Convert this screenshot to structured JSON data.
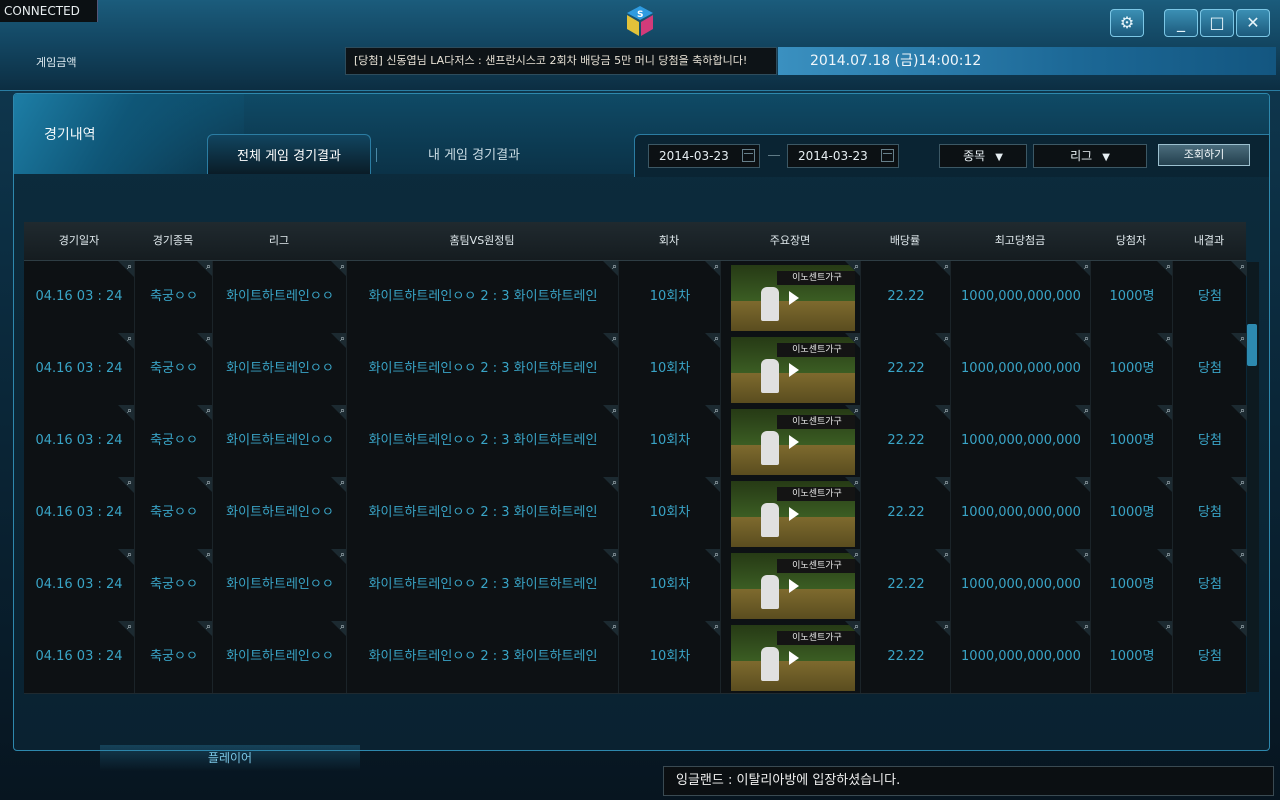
{
  "status": {
    "connection": "CONNECTED"
  },
  "header": {
    "game_amount_label": "게임금액",
    "ticker": "[당첨] 신동엽님 LA다저스 : 샌프란시스코 2회차 배당금 5만 머니 당첨을 축하합니다!",
    "datetime": "2014.07.18 (금)14:00:12"
  },
  "window_controls": {
    "settings_icon": "gear-icon",
    "minimize_icon": "minimize-icon",
    "maximize_icon": "maximize-icon",
    "close_icon": "close-icon"
  },
  "panel": {
    "title": "경기내역",
    "tabs": [
      {
        "label": "전체 게임 경기결과",
        "active": true
      },
      {
        "label": "내 게임 경기결과",
        "active": false
      }
    ],
    "filters": {
      "date_from": "2014-03-23",
      "date_to": "2014-03-23",
      "sport_select": "종목",
      "league_select": "리그",
      "search_button": "조회하기"
    }
  },
  "table": {
    "columns": [
      "경기일자",
      "경기종목",
      "리그",
      "홈팀VS원정팀",
      "회차",
      "주요장면",
      "배당률",
      "최고당첨금",
      "당첨자",
      "내결과"
    ],
    "rows": [
      {
        "date": "04.16  03 : 24",
        "sport": "축궁ㅇㅇ",
        "league": "화이트하트레인ㅇㅇ",
        "match": "화이트하트레인ㅇㅇ 2 : 3 화이트하트레인",
        "round": "10회차",
        "thumb_text": "이노센트가구",
        "odds": "22.22",
        "top_prize": "1000,000,000,000",
        "winners": "1000명",
        "my_result": "당첨"
      },
      {
        "date": "04.16  03 : 24",
        "sport": "축궁ㅇㅇ",
        "league": "화이트하트레인ㅇㅇ",
        "match": "화이트하트레인ㅇㅇ 2 : 3 화이트하트레인",
        "round": "10회차",
        "thumb_text": "이노센트가구",
        "odds": "22.22",
        "top_prize": "1000,000,000,000",
        "winners": "1000명",
        "my_result": "당첨"
      },
      {
        "date": "04.16  03 : 24",
        "sport": "축궁ㅇㅇ",
        "league": "화이트하트레인ㅇㅇ",
        "match": "화이트하트레인ㅇㅇ 2 : 3 화이트하트레인",
        "round": "10회차",
        "thumb_text": "이노센트가구",
        "odds": "22.22",
        "top_prize": "1000,000,000,000",
        "winners": "1000명",
        "my_result": "당첨"
      },
      {
        "date": "04.16  03 : 24",
        "sport": "축궁ㅇㅇ",
        "league": "화이트하트레인ㅇㅇ",
        "match": "화이트하트레인ㅇㅇ 2 : 3 화이트하트레인",
        "round": "10회차",
        "thumb_text": "이노센트가구",
        "odds": "22.22",
        "top_prize": "1000,000,000,000",
        "winners": "1000명",
        "my_result": "당첨"
      },
      {
        "date": "04.16  03 : 24",
        "sport": "축궁ㅇㅇ",
        "league": "화이트하트레인ㅇㅇ",
        "match": "화이트하트레인ㅇㅇ 2 : 3 화이트하트레인",
        "round": "10회차",
        "thumb_text": "이노센트가구",
        "odds": "22.22",
        "top_prize": "1000,000,000,000",
        "winners": "1000명",
        "my_result": "당첨"
      },
      {
        "date": "04.16  03 : 24",
        "sport": "축궁ㅇㅇ",
        "league": "화이트하트레인ㅇㅇ",
        "match": "화이트하트레인ㅇㅇ 2 : 3 화이트하트레인",
        "round": "10회차",
        "thumb_text": "이노센트가구",
        "odds": "22.22",
        "top_prize": "1000,000,000,000",
        "winners": "1000명",
        "my_result": "당첨"
      }
    ]
  },
  "footer": {
    "bottom_tab": "플레이어",
    "chat_message": "잉글랜드 : 이탈리아방에 입장하셨습니다."
  },
  "colors": {
    "accent": "#2d8ab0",
    "cell_text": "#39a4c6"
  }
}
